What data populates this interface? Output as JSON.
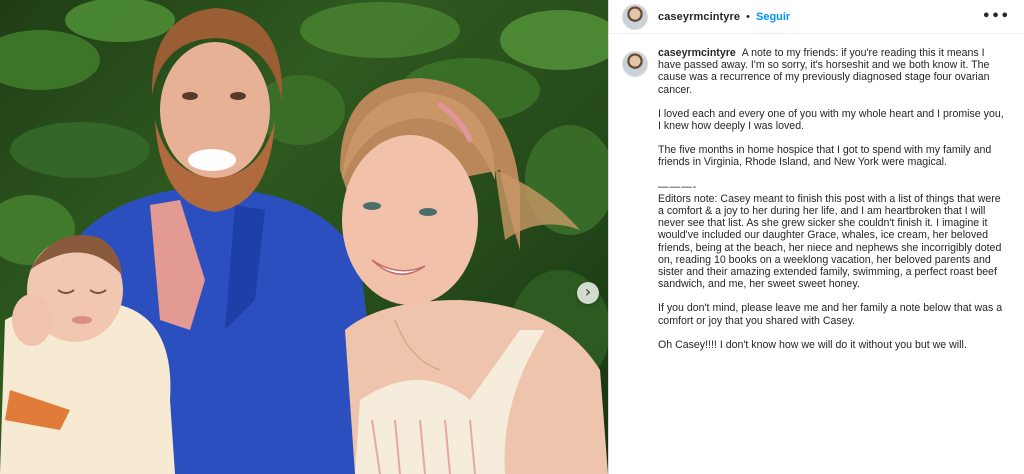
{
  "header": {
    "username": "caseyrmcintyre",
    "separator": "•",
    "follow_label": "Seguir",
    "more_icon": "more-horizontal-icon",
    "more_glyph": "•••"
  },
  "photo": {
    "next_icon": "chevron-right-icon",
    "next_glyph": "›"
  },
  "caption": {
    "username": "caseyrmcintyre",
    "p1": "A note to my friends: if you're reading this it means I have passed away. I'm so sorry, it's horseshit and we both know it. The cause was a recurrence of my previously diagnosed stage four ovarian cancer.",
    "p2": "I loved each and every one of you with my whole heart and I promise you, I knew how deeply I was loved.",
    "p3": "The five months in home hospice that I got to spend with my family and friends in Virginia, Rhode Island, and New York were magical.",
    "separator": "———-",
    "p4": "Editors note: Casey meant to finish this post with a list of things that were a comfort & a joy to her during her life, and I am heartbroken that I will never see that list. As she grew sicker she couldn't finish it. I imagine it would've included our daughter Grace, whales, ice cream, her beloved friends, being at the beach, her niece and nephews she incorrigibly doted on, reading 10 books on a weeklong vacation, her beloved parents and sister and their amazing extended family, swimming, a perfect roast beef sandwich, and me, her sweet sweet honey.",
    "p5": "If you don't mind, please leave me and her family a note below that was a comfort or joy that you shared with Casey.",
    "p6": "Oh Casey!!!! I don't know how we will do it without you but we will."
  }
}
